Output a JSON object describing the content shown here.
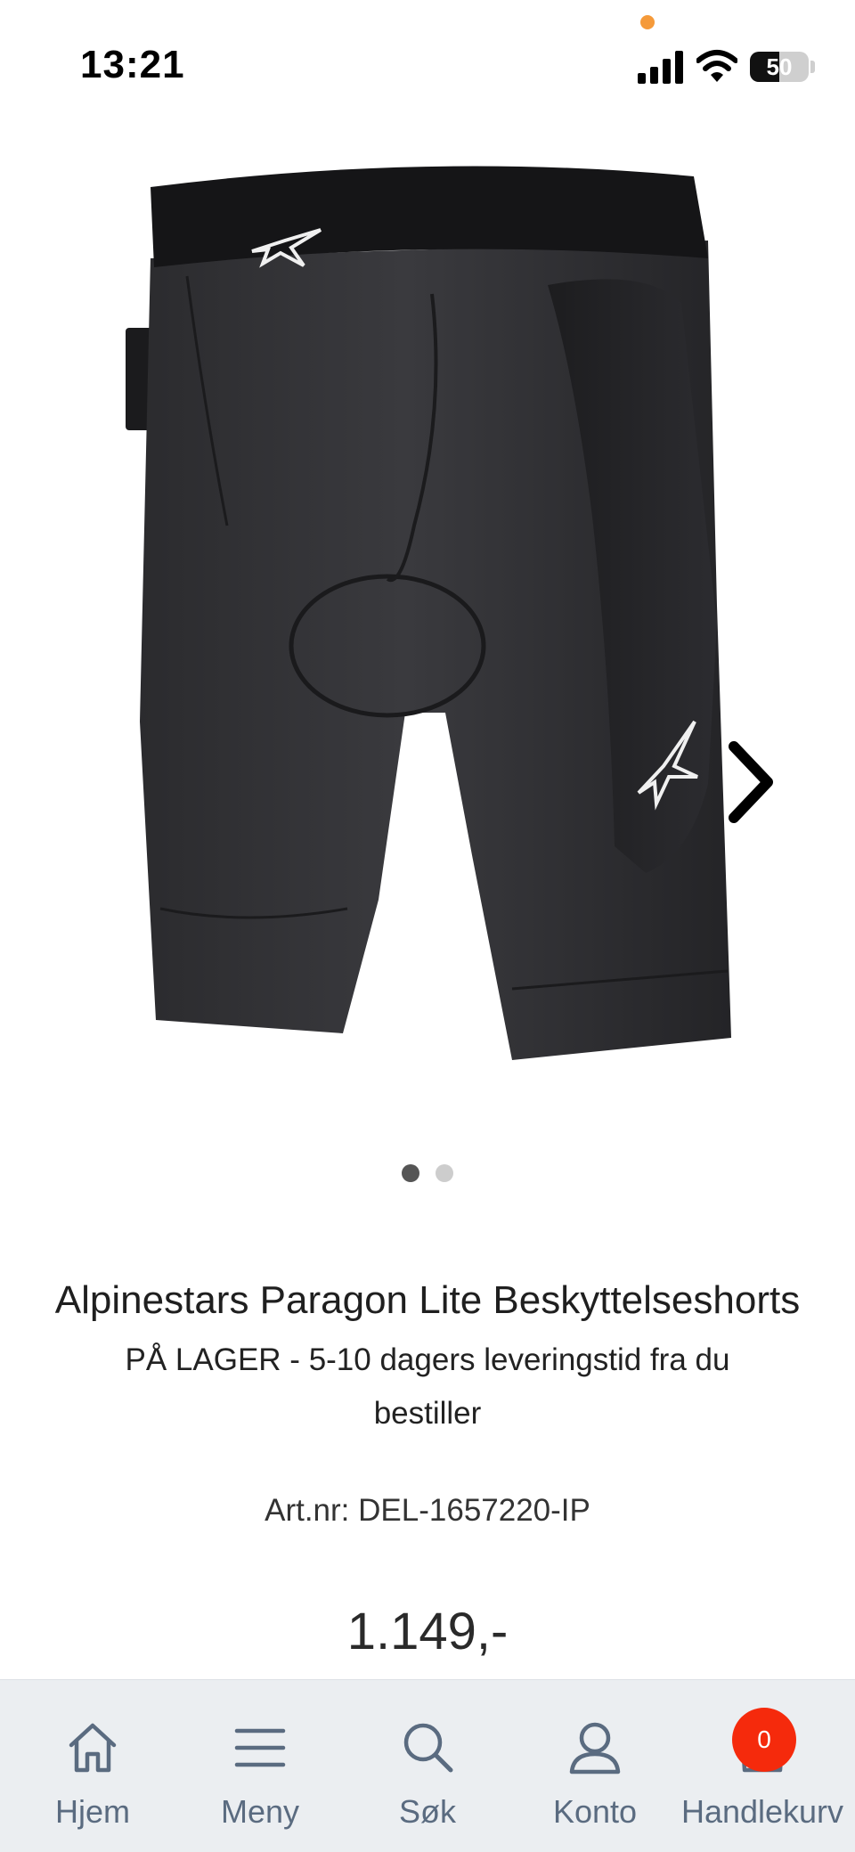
{
  "status_bar": {
    "time": "13:21",
    "battery_percent": "50",
    "battery_level": 0.5
  },
  "gallery": {
    "image_icon": "shorts-product-image",
    "brand_logo_icon": "alpinestars-star-logo",
    "next_icon": "chevron-right-icon",
    "slide_count": 2,
    "active_slide": 1
  },
  "product": {
    "title": "Alpinestars Paragon Lite Beskyttelseshorts",
    "stock_status": "PÅ LAGER - 5-10 dagers leveringstid fra du bestiller",
    "article_label": "Art.nr:",
    "article_number": "DEL-1657220-IP",
    "price": "1.149,-"
  },
  "bottom_nav": {
    "items": [
      {
        "label": "Hjem",
        "icon": "home-icon"
      },
      {
        "label": "Meny",
        "icon": "menu-icon"
      },
      {
        "label": "Søk",
        "icon": "search-icon"
      },
      {
        "label": "Konto",
        "icon": "user-icon"
      },
      {
        "label": "Handlekurv",
        "icon": "cart-icon"
      }
    ],
    "cart_count": "0"
  },
  "colors": {
    "accent_badge": "#f52a0c",
    "nav_background": "#ebeef1",
    "nav_text": "#5a6b80",
    "privacy_dot": "#f59a3a"
  }
}
